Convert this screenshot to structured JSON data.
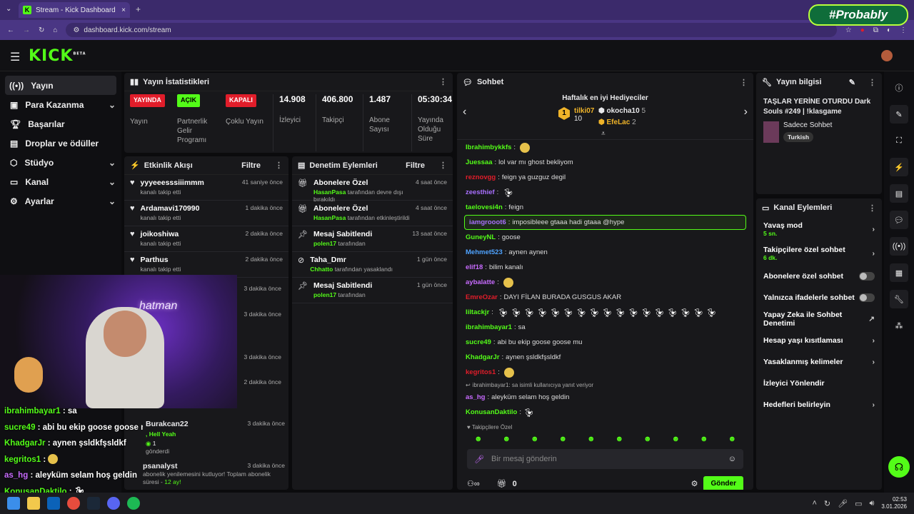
{
  "browser": {
    "tab_title": "Stream - Kick Dashboard",
    "url": "dashboard.kick.com/stream",
    "tab_add": "+",
    "tab_close": "×"
  },
  "overlay": {
    "brand": "#Probably"
  },
  "nav": {
    "logo": "KICK",
    "beta": "BETA"
  },
  "sidebar": {
    "items": [
      {
        "label": "Yayın",
        "icon": "broadcast-icon",
        "expand": false
      },
      {
        "label": "Para Kazanma",
        "icon": "money-icon",
        "expand": true
      },
      {
        "label": "Başarılar",
        "icon": "trophy-icon",
        "expand": false
      },
      {
        "label": "Droplar ve ödüller",
        "icon": "gift-icon",
        "expand": false
      },
      {
        "label": "Stüdyo",
        "icon": "studio-icon",
        "expand": true
      },
      {
        "label": "Kanal",
        "icon": "channel-icon",
        "expand": true
      },
      {
        "label": "Ayarlar",
        "icon": "gear-icon",
        "expand": true
      }
    ]
  },
  "stats": {
    "title": "Yayın İstatistikleri",
    "items": [
      {
        "badge": "YAYINDA",
        "badge_color": "#e11d2a",
        "label": "Yayın"
      },
      {
        "badge": "AÇIK",
        "badge_color": "#53fc18",
        "label": "Partnerlik Gelir Programı"
      },
      {
        "badge": "KAPALI",
        "badge_color": "#e11d2a",
        "label": "Çoklu Yayın"
      },
      {
        "value": "14.908",
        "label": "İzleyici"
      },
      {
        "value": "406.800",
        "label": "Takipçi"
      },
      {
        "value": "1.487",
        "label": "Abone Sayısı"
      },
      {
        "value": "05:30:34",
        "label": "Yayında Olduğu Süre"
      }
    ]
  },
  "activity": {
    "title": "Etkinlik Akışı",
    "filter": "Filtre",
    "events": [
      {
        "name": "yyyeeesssiiimmm",
        "sub": "kanalı takip etti",
        "time": "41 saniye önce"
      },
      {
        "name": "Ardamavi170990",
        "sub": "kanalı takip etti",
        "time": "1 dakika önce"
      },
      {
        "name": "joikoshiwa",
        "sub": "kanalı takip etti",
        "time": "2 dakika önce"
      },
      {
        "name": "Parthus",
        "sub": "kanalı takip etti",
        "time": "2 dakika önce"
      }
    ],
    "partial_times": [
      "3 dakika önce",
      "3 dakika önce",
      "3 dakika önce",
      "2 dakika önce"
    ],
    "gift": {
      "name": "Burakcan22",
      "msg": ", Hell Yeah",
      "count": "1",
      "sent": "gönderdi",
      "time": "3 dakika önce"
    },
    "sub": {
      "name": "psanalyst",
      "msg": "abonelik yenilemesini kutluyor! Toplam abonelik süresi -",
      "months": "12",
      "unit": "ay!",
      "time": "3 dakika önce"
    }
  },
  "moderation": {
    "title": "Denetim Eylemleri",
    "filter": "Filtre",
    "events": [
      {
        "name": "Abonelere Özel",
        "actor": "HasanPasa",
        "sub": " tarafından devre dışı bırakıldı",
        "time": "4 saat önce",
        "icon": "gift-icon"
      },
      {
        "name": "Abonelere Özel",
        "actor": "HasanPasa",
        "sub": " tarafından etkinleştirildi",
        "time": "4 saat önce",
        "icon": "gift-icon"
      },
      {
        "name": "Mesaj Sabitlendi",
        "actor": "polen17",
        "sub": " tarafından",
        "time": "13 saat önce",
        "icon": "pin-icon"
      },
      {
        "name": "Taha_Dmr",
        "actor": "Chhatto",
        "sub": " tarafından yasaklandı",
        "time": "1 gün önce",
        "icon": "ban-icon"
      },
      {
        "name": "Mesaj Sabitlendi",
        "actor": "polen17",
        "sub": " tarafından",
        "time": "1 gün önce",
        "icon": "pin-icon"
      }
    ]
  },
  "chat": {
    "title": "Sohbet",
    "gifters_title": "Haftalık en iyi Hediyeciler",
    "gifters": [
      {
        "rank": "1",
        "name": "tilki07",
        "count": "10"
      },
      {
        "name": "okocha10",
        "count": "5"
      },
      {
        "name": "EfeLac",
        "count": "2"
      }
    ],
    "messages": [
      {
        "user": "Ibrahimbykkfs",
        "color": "#53fc18",
        "text": ""
      },
      {
        "user": "Juessaa",
        "color": "#53fc18",
        "text": "lol var mı ghost bekliyom"
      },
      {
        "user": "reznovgg",
        "color": "#e11d2a",
        "text": "feign ya guzguz degil"
      },
      {
        "user": "zeesthief",
        "color": "#a970ff",
        "text": ""
      },
      {
        "user": "taelovesi4n",
        "color": "#53fc18",
        "text": "feign"
      },
      {
        "user": "iamgrooot6",
        "color": "#a970ff",
        "text": "imposibleee gtaaa hadi gtaaa @hype",
        "highlight": true
      },
      {
        "user": "GuneyNL",
        "color": "#53fc18",
        "text": "goose"
      },
      {
        "user": "Mehmet523",
        "color": "#4fa3ff",
        "text": "aynen aynen"
      },
      {
        "user": "elif18",
        "color": "#c86bff",
        "text": "bilim kanalı"
      },
      {
        "user": "aybalatte",
        "color": "#c86bff",
        "text": ""
      },
      {
        "user": "EmreOzar",
        "color": "#e11d2a",
        "text": "DAYI FİLAN BURADA GUSGUS AKAR"
      },
      {
        "user": "liltackjr",
        "color": "#53fc18",
        "text": ""
      },
      {
        "user": "ibrahimbayar1",
        "color": "#53fc18",
        "text": "sa"
      },
      {
        "user": "sucre49",
        "color": "#53fc18",
        "text": "abi bu ekip goose goose mu"
      },
      {
        "user": "KhadgarJr",
        "color": "#53fc18",
        "text": "aynen şsldkfşsldkf"
      },
      {
        "user": "kegritos1",
        "color": "#e11d2a",
        "text": ""
      }
    ],
    "reply_note": "ibrahimbayar1: sa isimli kullanıcıya yanıt veriyor",
    "reply": {
      "user": "as_hg",
      "color": "#c86bff",
      "text": "aleyküm selam hoş geldin"
    },
    "last": {
      "user": "KonusanDaktilo",
      "color": "#53fc18",
      "text": ""
    },
    "followers_only": "Takipçilere Özel",
    "input_placeholder": "Bir mesaj gönderin",
    "points": "0",
    "send": "Gönder"
  },
  "stream_info": {
    "title": "Yayın bilgisi",
    "stream_title": "TAŞLAR YERİNE OTURDU Dark Souls #249 | !klasgame",
    "category": "Sadece Sohbet",
    "language": "Turkish"
  },
  "channel_actions": {
    "title": "Kanal Eylemleri",
    "items": [
      {
        "label": "Yavaş mod",
        "sub": "5 sn.",
        "type": "arrow"
      },
      {
        "label": "Takipçilere özel sohbet",
        "sub": "6 dk.",
        "type": "arrow"
      },
      {
        "label": "Abonelere özel sohbet",
        "type": "toggle"
      },
      {
        "label": "Yalnızca ifadelerle sohbet",
        "type": "toggle"
      },
      {
        "label": "Yapay Zeka ile Sohbet Denetimi",
        "type": "external"
      },
      {
        "label": "Hesap yaşı kısıtlaması",
        "type": "arrow"
      },
      {
        "label": "Yasaklanmış kelimeler",
        "type": "arrow"
      },
      {
        "label": "İzleyici Yönlendir",
        "type": "none"
      },
      {
        "label": "Hedefleri belirleyin",
        "type": "arrow"
      }
    ]
  },
  "overlay_chat": [
    {
      "user": "ibrahimbayar1",
      "text": "sa",
      "color": "#53fc18"
    },
    {
      "user": "sucre49",
      "text": "abi bu ekip goose goose mu",
      "color": "#53fc18"
    },
    {
      "user": "KhadgarJr",
      "text": "aynen şsldkfşsldkf",
      "color": "#53fc18"
    },
    {
      "user": "kegritos1",
      "text": "",
      "color": "#53fc18"
    },
    {
      "user": "as_hg",
      "text": "aleyküm selam hoş geldin",
      "color": "#c86bff"
    },
    {
      "user": "KonusanDaktilo",
      "text": "",
      "color": "#53fc18"
    }
  ],
  "webcam": {
    "neon": "hatman"
  },
  "taskbar": {
    "time": "02:53",
    "date": "3.01.2026"
  }
}
